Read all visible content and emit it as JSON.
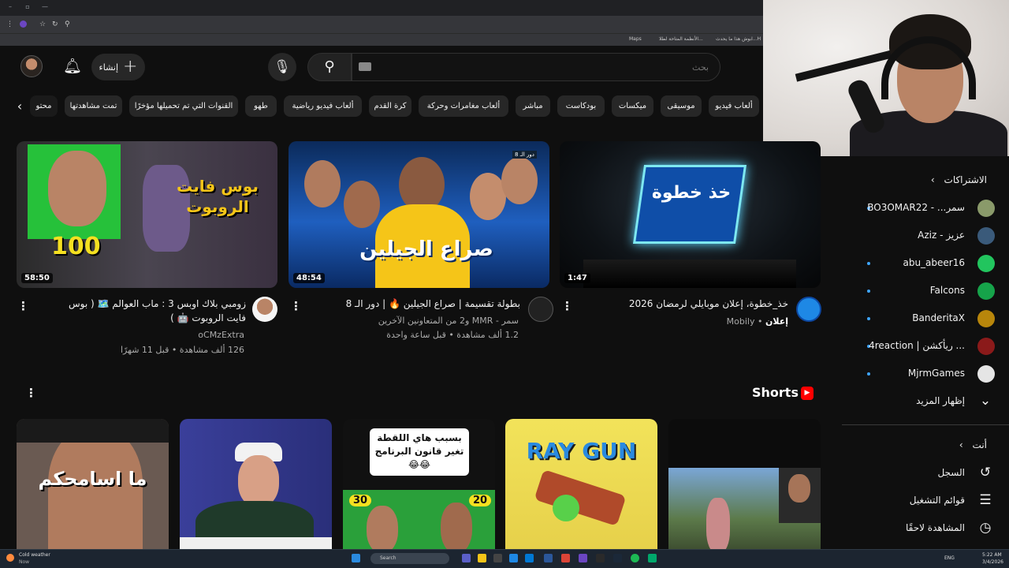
{
  "browser": {
    "bookmarks": [
      "Maps",
      "الأنظمة المتاحة لطلا...",
      "ابوش هذا ما يحدث...H"
    ]
  },
  "header": {
    "create_label": "إنشاء",
    "search_placeholder": "بحث"
  },
  "chips": [
    "ألعاب فيديو",
    "موسيقى",
    "ميكسات",
    "بودكاست",
    "مباشر",
    "ألعاب مغامرات وحركة",
    "كرة القدم",
    "ألعاب فيديو رياضية",
    "طهو",
    "القنوات التي تم تحميلها مؤخرًا",
    "تمت مشاهدتها",
    "محتو"
  ],
  "videos": [
    {
      "title": "خذ_خطوة، إعلان موبايلي لرمضان 2026",
      "ad_label": "إعلان",
      "channel": "Mobily",
      "duration": "1:47",
      "thumb_text": "خذ خطوة"
    },
    {
      "title": "بطولة تقسيمة | صراع الجيلين 🔥 | دور الـ 8",
      "channel": "سمر - MMR و2 من المتعاونين الآخرين",
      "meta": "1.2 ألف مشاهدة • قبل ساعة واحدة",
      "duration": "48:54",
      "thumb_text": "صراع الجيلين",
      "thumb_badge": "دور الـ 8"
    },
    {
      "title": "زومبي بلاك اوبس 3 : ماب العوالم 🗺️ ( بوس فايت الروبوت 🤖 )",
      "channel": "oCMzExtra",
      "meta": "126 ألف مشاهدة • قبل 11 شهرًا",
      "duration": "58:50",
      "thumb_text": "بوس فايت الروبوت",
      "thumb_num": "100"
    }
  ],
  "shorts": {
    "title": "Shorts",
    "items": [
      {
        "text": ""
      },
      {
        "text": "RAY GUN"
      },
      {
        "text": "بسبب هاي اللقطة تغير قانون البرنامج 😂😂",
        "n1": "30",
        "n2": "20"
      },
      {
        "text": ""
      },
      {
        "text": "ما اسامحكم"
      }
    ]
  },
  "sidebar": {
    "subscriptions_heading": "الاشتراكات",
    "subscriptions": [
      {
        "name": "BO3OMAR22 - ...سمر",
        "color": "#8a9a6a"
      },
      {
        "name": "Aziz - عزيز",
        "color": "#3a5a7a"
      },
      {
        "name": "abu_abeer16",
        "color": "#22c55e"
      },
      {
        "name": "Falcons",
        "color": "#16a34a"
      },
      {
        "name": "BanderitaX",
        "color": "#b8860b"
      },
      {
        "name": "4reaction | ريأكشن ...",
        "color": "#8b1a1a"
      },
      {
        "name": "MjrmGames",
        "color": "#e5e5e5"
      }
    ],
    "show_more": "إظهار المزيد",
    "you_heading": "أنت",
    "you_items": [
      {
        "label": "السجل",
        "icon": "history-icon"
      },
      {
        "label": "قوائم التشغيل",
        "icon": "playlists-icon"
      },
      {
        "label": "المشاهدة لاحقًا",
        "icon": "watch-later-icon"
      }
    ]
  },
  "taskbar": {
    "weather": "Cold weather",
    "weather_sub": "Now",
    "search": "Search",
    "lang": "ENG",
    "time": "5:22 AM",
    "date": "3/4/2026"
  }
}
